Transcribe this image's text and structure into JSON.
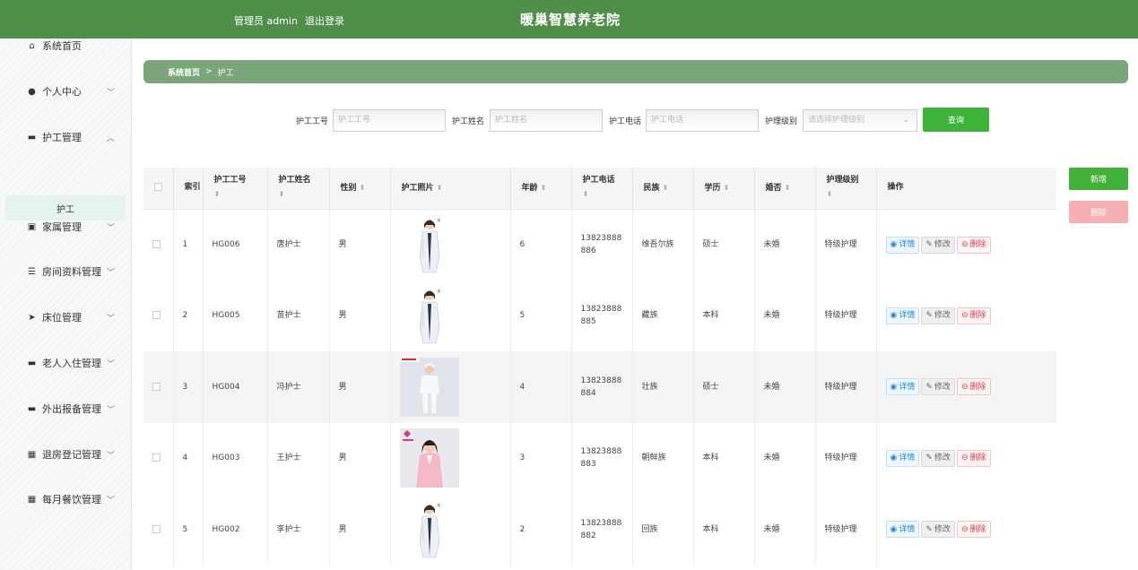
{
  "header": {
    "user_label": "管理员 admin",
    "logout_label": "退出登录",
    "title": "暖巢智慧养老院"
  },
  "sidebar": {
    "items": [
      {
        "label": "系统首页",
        "icon": "home-icon",
        "glyph": "⌂"
      },
      {
        "label": "个人中心",
        "icon": "user-icon",
        "glyph": "●"
      },
      {
        "label": "护工管理",
        "icon": "message-icon",
        "glyph": "▬"
      },
      {
        "label": "家属管理",
        "icon": "document-icon",
        "glyph": "▣"
      },
      {
        "label": "房间资料管理",
        "icon": "list-icon",
        "glyph": "☰"
      },
      {
        "label": "床位管理",
        "icon": "send-icon",
        "glyph": "➤"
      },
      {
        "label": "老人入住管理",
        "icon": "monitor-icon",
        "glyph": "▬"
      },
      {
        "label": "外出报备管理",
        "icon": "monitor-icon",
        "glyph": "▬"
      },
      {
        "label": "退房登记管理",
        "icon": "grid-icon",
        "glyph": "▦"
      },
      {
        "label": "每月餐饮管理",
        "icon": "grid-icon",
        "glyph": "▦"
      }
    ],
    "submenu_label": "护工"
  },
  "breadcrumb": {
    "home": "系统首页",
    "separator": ">",
    "current": "护工"
  },
  "search": {
    "fields": [
      {
        "label": "护工工号",
        "placeholder": "护工工号"
      },
      {
        "label": "护工姓名",
        "placeholder": "护工姓名"
      },
      {
        "label": "护工电话",
        "placeholder": "护工电话"
      },
      {
        "label": "护理级别",
        "placeholder": "请选择护理级别"
      }
    ],
    "button_label": "查询"
  },
  "actions": {
    "add_label": "新增",
    "delete_label": "删除"
  },
  "table": {
    "headers": {
      "index": "索引",
      "worker_id": "护工工号",
      "name": "护工姓名",
      "gender": "性别",
      "photo": "护工照片",
      "age": "年龄",
      "phone": "护工电话",
      "ethnicity": "民族",
      "education": "学历",
      "marital": "婚否",
      "care_level": "护理级别",
      "ops": "操作"
    },
    "row_actions": {
      "detail": "详情",
      "edit": "修改",
      "remove": "删除"
    },
    "rows": [
      {
        "index": "1",
        "worker_id": "HG006",
        "name": "唐护士",
        "gender": "男",
        "photo": "white-coat",
        "age": "6",
        "phone": "13823888886",
        "ethnicity": "维吾尔族",
        "education": "硕士",
        "marital": "未婚",
        "care_level": "特级护理"
      },
      {
        "index": "2",
        "worker_id": "HG005",
        "name": "苗护士",
        "gender": "男",
        "photo": "white-coat",
        "age": "5",
        "phone": "13823888885",
        "ethnicity": "藏族",
        "education": "本科",
        "marital": "未婚",
        "care_level": "特级护理"
      },
      {
        "index": "3",
        "worker_id": "HG004",
        "name": "冯护士",
        "gender": "男",
        "photo": "white-uniform",
        "age": "4",
        "phone": "13823888884",
        "ethnicity": "壮族",
        "education": "硕士",
        "marital": "未婚",
        "care_level": "特级护理"
      },
      {
        "index": "4",
        "worker_id": "HG003",
        "name": "王护士",
        "gender": "男",
        "photo": "pink-uniform",
        "age": "3",
        "phone": "13823888883",
        "ethnicity": "朝鲜族",
        "education": "本科",
        "marital": "未婚",
        "care_level": "特级护理"
      },
      {
        "index": "5",
        "worker_id": "HG002",
        "name": "李护士",
        "gender": "男",
        "photo": "white-coat",
        "age": "2",
        "phone": "13823888882",
        "ethnicity": "回族",
        "education": "本科",
        "marital": "未婚",
        "care_level": "特级护理"
      }
    ]
  },
  "colors": {
    "header": "#4f8f49",
    "breadcrumb": "#7aa67a",
    "primary": "#3fb23a",
    "danger_light": "#f6b0b4"
  }
}
